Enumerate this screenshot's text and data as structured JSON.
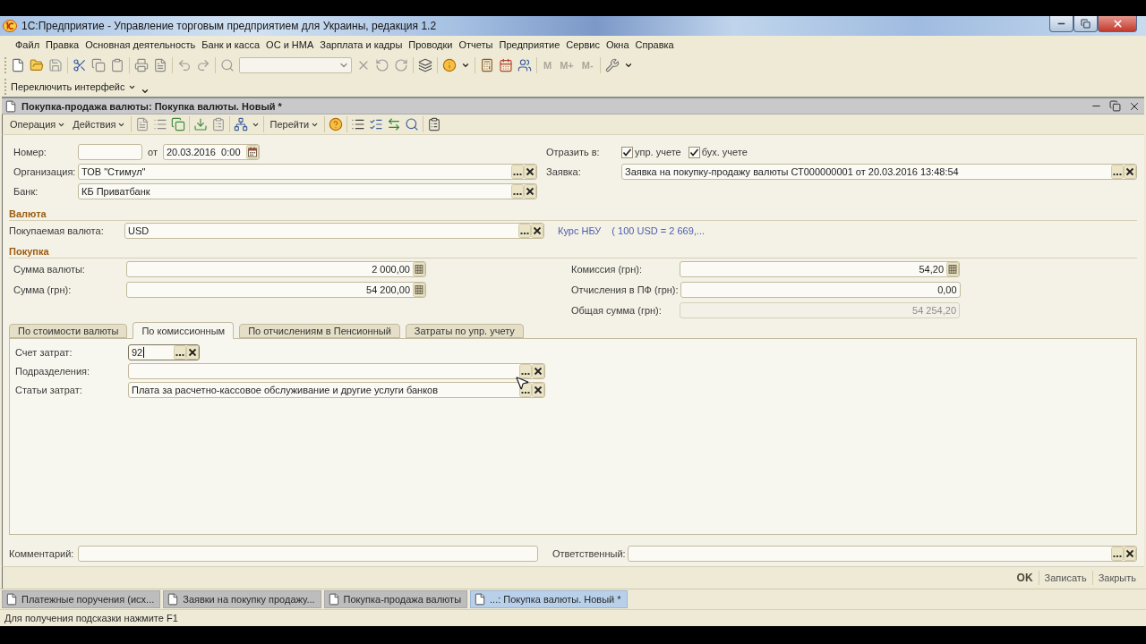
{
  "window": {
    "title": "1С:Предприятие - Управление торговым предприятием для Украины, редакция 1.2"
  },
  "menu": [
    {
      "label": "Файл"
    },
    {
      "label": "Правка"
    },
    {
      "label": "Основная деятельность"
    },
    {
      "label": "Банк и касса"
    },
    {
      "label": "ОС и НМА"
    },
    {
      "label": "Зарплата и кадры"
    },
    {
      "label": "Проводки"
    },
    {
      "label": "Отчеты"
    },
    {
      "label": "Предприятие"
    },
    {
      "label": "Сервис"
    },
    {
      "label": "Окна"
    },
    {
      "label": "Справка"
    }
  ],
  "toolbar": {
    "memory_buttons": [
      {
        "label": "M",
        "disabled": true
      },
      {
        "label": "M+",
        "disabled": true
      },
      {
        "label": "M-",
        "disabled": true
      }
    ]
  },
  "interface_bar": {
    "switch_label": "Переключить интерфейс"
  },
  "document": {
    "title": "Покупка-продажа валюты: Покупка валюты. Новый *",
    "menus": [
      {
        "label": "Операция"
      },
      {
        "label": "Действия"
      }
    ],
    "goto_label": "Перейти"
  },
  "form": {
    "number": {
      "label": "Номер:"
    },
    "date": {
      "label": "от",
      "value": "20.03.2016  0:00"
    },
    "organization": {
      "label": "Организация:",
      "value": "ТОВ \"Стимул\""
    },
    "bank": {
      "label": "Банк:",
      "value": "КБ Приватбанк"
    },
    "reflect": {
      "label": "Отразить в:",
      "options": [
        {
          "label": "упр. учете",
          "checked": true
        },
        {
          "label": "бух. учете",
          "checked": true
        }
      ]
    },
    "request": {
      "label": "Заявка:",
      "value": "Заявка на покупку-продажу валюты СТ000000001 от 20.03.2016 13:48:54"
    },
    "currency": {
      "title": "Валюта",
      "label": "Покупаемая валюта:",
      "value": "USD",
      "rate_link": "Курс НБУ",
      "rate_value": "( 100 USD = 2 669,..."
    },
    "purchase": {
      "title": "Покупка",
      "left": [
        {
          "label": "Сумма валюты:",
          "value": "2 000,00",
          "kind": "calc",
          "disabled": false
        },
        {
          "label": "Сумма (грн):",
          "value": "54 200,00",
          "kind": "calc",
          "disabled": false
        }
      ],
      "right": [
        {
          "label": "Комиссия (грн):",
          "value": "54,20",
          "kind": "calc",
          "disabled": false
        },
        {
          "label": "Отчисления в ПФ (грн):",
          "value": "0,00",
          "kind": "plain",
          "disabled": false
        },
        {
          "label": "Общая сумма (грн):",
          "value": "54 254,20",
          "kind": "plain",
          "disabled": true
        }
      ]
    },
    "tabs": [
      {
        "label": "По стоимости валюты",
        "selected": false
      },
      {
        "label": "По комиссионным",
        "selected": true
      },
      {
        "label": "По отчислениям в Пенсионный",
        "selected": false
      },
      {
        "label": "Затраты по упр. учету",
        "selected": false
      }
    ],
    "tab_fields": [
      {
        "label": "Счет затрат:",
        "value": "92",
        "kind": "short",
        "focused": true
      },
      {
        "label": "Подразделения:",
        "kind": "wide",
        "focused": false
      },
      {
        "label": "Статьи затрат:",
        "value": "Плата за расчетно-кассовое обслуживание и другие услуги банков",
        "kind": "wide",
        "focused": false
      }
    ],
    "comment": {
      "label": "Комментарий:"
    },
    "responsible": {
      "label": "Ответственный:"
    }
  },
  "buttons": [
    {
      "label": "OK",
      "default": true
    },
    {
      "label": "Записать",
      "default": false
    },
    {
      "label": "Закрыть",
      "default": false
    }
  ],
  "open_windows": [
    {
      "label": "Платежные поручения (исх...",
      "selected": false
    },
    {
      "label": "Заявки на покупку продажу...",
      "selected": false
    },
    {
      "label": "Покупка-продажа валюты",
      "selected": false
    },
    {
      "label": "...: Покупка валюты. Новый *",
      "selected": true
    }
  ],
  "status_bar": {
    "text": "Для получения подсказки нажмите F1"
  }
}
